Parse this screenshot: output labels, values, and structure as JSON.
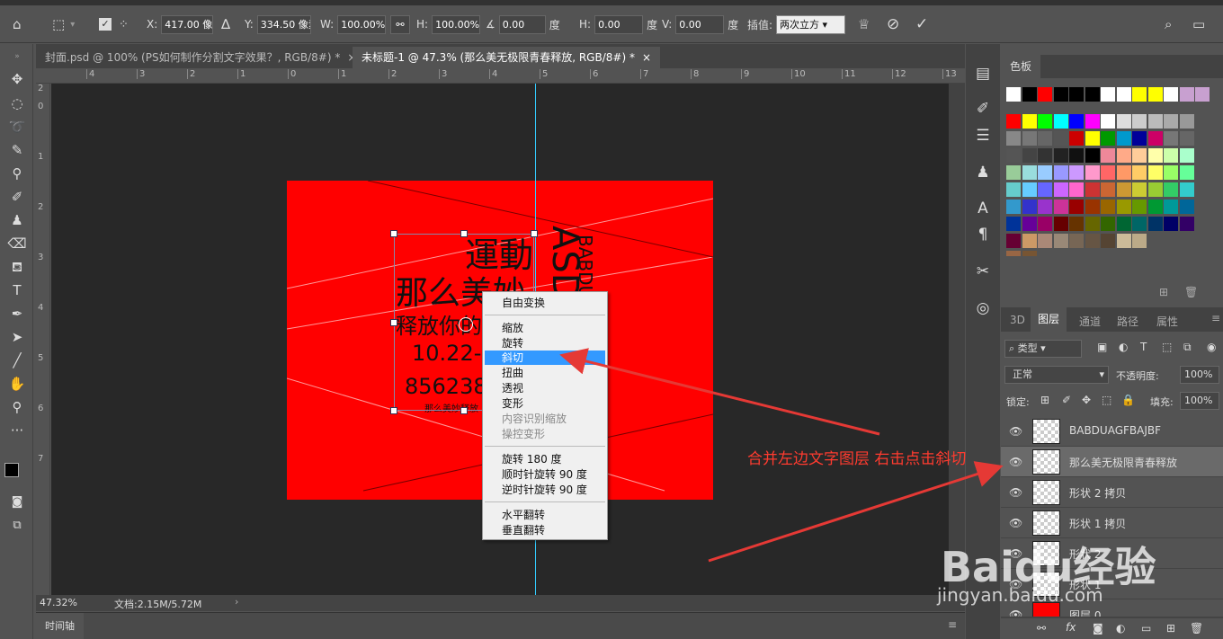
{
  "options_bar": {
    "x_label": "X:",
    "x_value": "417.00 像素",
    "y_label": "Y:",
    "y_value": "334.50 像素",
    "w_label": "W:",
    "w_value": "100.00%",
    "h_label": "H:",
    "h_value": "100.00%",
    "angle_value": "0.00",
    "angle_unit": "度",
    "hskew_label": "H:",
    "hskew_value": "0.00",
    "hskew_unit": "度",
    "vskew_label": "V:",
    "vskew_value": "0.00",
    "vskew_unit": "度",
    "interp_label": "插值:",
    "interp_value": "两次立方"
  },
  "tabs": [
    {
      "label": "封面.psd @ 100% (PS如何制作分割文字效果？, RGB/8#) *",
      "close": "×"
    },
    {
      "label": "未标题-1 @ 47.3% (那么美无极限青春释放, RGB/8#) *",
      "close": "×"
    }
  ],
  "ruler_h": [
    "4",
    "3",
    "2",
    "1",
    "0",
    "1",
    "2",
    "3",
    "4",
    "5",
    "6",
    "7",
    "8",
    "9",
    "10",
    "11",
    "12",
    "13"
  ],
  "ruler_v": [
    "2",
    "0",
    "1",
    "2",
    "3",
    "4",
    "5",
    "6",
    "7"
  ],
  "artwork": {
    "line1": "運動",
    "line2": "那么美妙",
    "line3": "释放你的",
    "line4": "10.22-1",
    "line5": "856238",
    "line6": "那么美妙释放",
    "vert1": "ASD",
    "vert2": "BABDU"
  },
  "context_menu": {
    "items": [
      {
        "label": "自由变换",
        "state": "normal"
      },
      {
        "label": "缩放",
        "state": "normal"
      },
      {
        "label": "旋转",
        "state": "normal"
      },
      {
        "label": "斜切",
        "state": "selected"
      },
      {
        "label": "扭曲",
        "state": "normal"
      },
      {
        "label": "透视",
        "state": "normal"
      },
      {
        "label": "变形",
        "state": "normal"
      },
      {
        "label": "内容识别缩放",
        "state": "disabled"
      },
      {
        "label": "操控变形",
        "state": "disabled"
      },
      {
        "label": "旋转 180 度",
        "state": "normal"
      },
      {
        "label": "顺时针旋转 90 度",
        "state": "normal"
      },
      {
        "label": "逆时针旋转 90 度",
        "state": "normal"
      },
      {
        "label": "水平翻转",
        "state": "normal"
      },
      {
        "label": "垂直翻转",
        "state": "normal"
      }
    ]
  },
  "annotation": "合并左边文字图层 右击点击斜切",
  "status": {
    "zoom": "47.32%",
    "doc": "文档:2.15M/5.72M"
  },
  "timeline_label": "时间轴",
  "swatches_title": "色板",
  "layers_tabs": [
    "3D",
    "图层",
    "通道",
    "路径",
    "属性"
  ],
  "layers_filter": "类型",
  "blend_mode": "正常",
  "opacity_label": "不透明度:",
  "opacity_value": "100%",
  "lock_label": "锁定:",
  "fill_label": "填充:",
  "fill_value": "100%",
  "layers": [
    {
      "name": "BABDUAGFBAJBF"
    },
    {
      "name": "那么美无极限青春释放"
    },
    {
      "name": "形状 2 拷贝"
    },
    {
      "name": "形状 1 拷贝"
    },
    {
      "name": "形状 2"
    },
    {
      "name": "形状 1"
    },
    {
      "name": "图层 0"
    }
  ],
  "watermark": {
    "brand": "Baidu经验",
    "url": "jingyan.baidu.com"
  },
  "colors": {
    "accent_selected": "#3399ff",
    "doc_red": "#ff0000",
    "arrow": "#e53935"
  }
}
